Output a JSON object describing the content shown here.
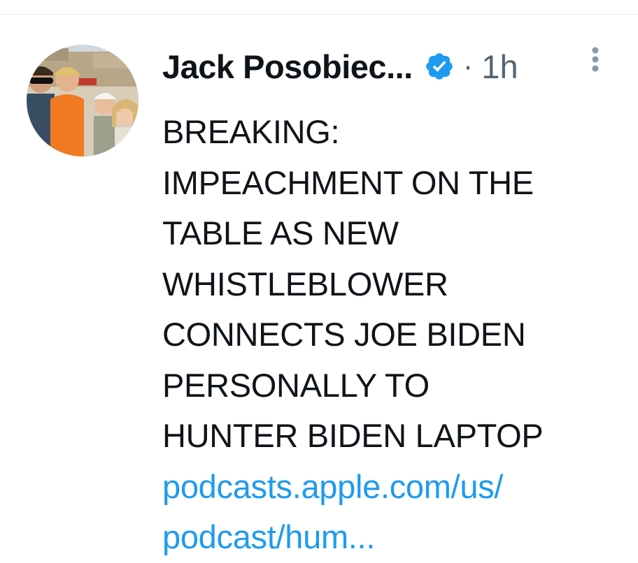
{
  "tweet": {
    "author": {
      "display_name": "Jack Posobiec...",
      "verified": true,
      "avatar_icon": "profile-photo-avatar"
    },
    "separator": "·",
    "timestamp": "1h",
    "more_icon": "more-vertical-icon",
    "text_lines": [
      "BREAKING:",
      "IMPEACHMENT ON THE",
      "TABLE AS NEW",
      "WHISTLEBLOWER",
      "CONNECTS JOE BIDEN",
      "PERSONALLY TO",
      "HUNTER BIDEN LAPTOP"
    ],
    "link_lines": [
      "podcasts.apple.com/us/",
      "podcast/hum..."
    ]
  },
  "colors": {
    "text": "#0f1419",
    "muted": "#536471",
    "link": "#1d9bf0",
    "verified_badge": "#1d9bf0",
    "divider": "#e6ecf0"
  }
}
